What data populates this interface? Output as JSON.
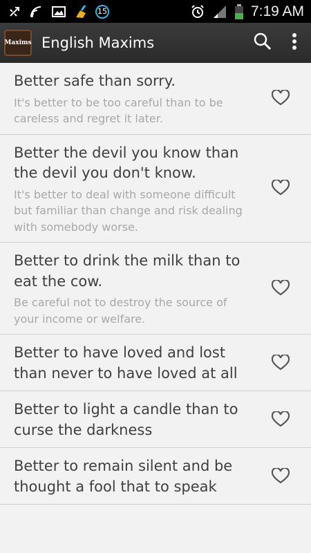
{
  "status_bar": {
    "notification_count": "15",
    "time": "7:19 AM",
    "accent": "#35b5e5"
  },
  "app_bar": {
    "logo_text": "Maxims",
    "title": "English Maxims",
    "background": "#333333"
  },
  "items": [
    {
      "title": "Better safe than sorry.",
      "description": "It's better to be too careful than to be careless and regret it later."
    },
    {
      "title": "Better the devil you know than the devil you don't know.",
      "description": "It's better to deal with someone difficult but familiar than change and risk dealing with somebody worse."
    },
    {
      "title": "Better to drink the milk than to eat the cow.",
      "description": "Be careful not to destroy the source of your income or welfare."
    },
    {
      "title": "Better to have loved and lost than never to have loved at all",
      "description": ""
    },
    {
      "title": "Better to light a candle than to curse the darkness",
      "description": ""
    },
    {
      "title": "Better to remain silent and be thought a fool that to speak",
      "description": ""
    }
  ]
}
